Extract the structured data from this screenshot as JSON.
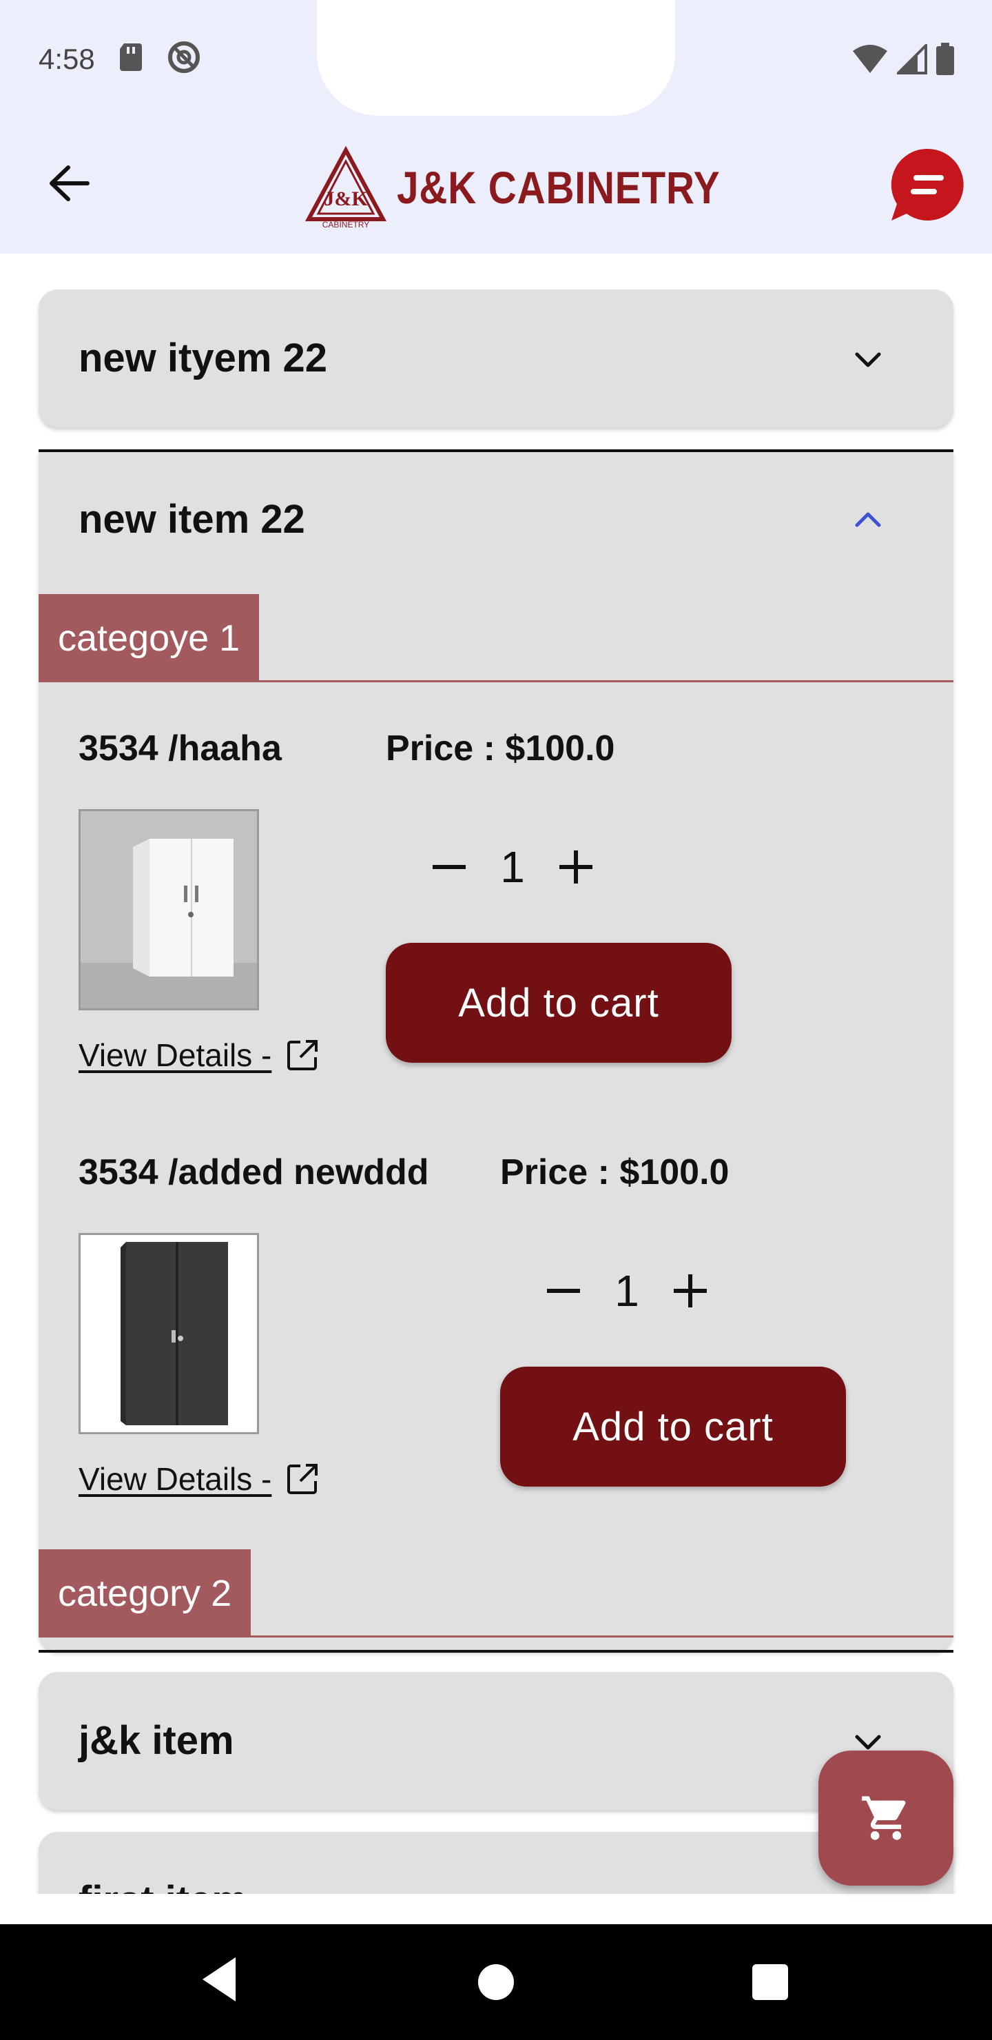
{
  "status_bar": {
    "time": "4:58",
    "icons": [
      "sd-card-icon",
      "do-not-disturb-icon",
      "wifi-icon",
      "signal-icon",
      "battery-icon"
    ]
  },
  "app_bar": {
    "logo_text": "J&K CABINETRY",
    "logo_mark_text": "J&K",
    "logo_mark_sub": "CABINETRY",
    "icons": [
      "back-arrow-icon",
      "chat-bubble-icon"
    ]
  },
  "sections": [
    {
      "title": "new ityem 22",
      "expanded": false
    },
    {
      "title": "new item 22",
      "expanded": true,
      "categories": [
        {
          "name": "categoye 1",
          "products": [
            {
              "name": "3534 /haaha",
              "price": "Price : $100.0",
              "quantity": "1",
              "view_details": "View Details -",
              "add_to_cart": "Add to cart",
              "image": "white-cabinet"
            },
            {
              "name": "3534 /added newddd",
              "price": "Price : $100.0",
              "quantity": "1",
              "view_details": "View Details -",
              "add_to_cart": "Add to cart",
              "image": "black-cabinet"
            }
          ]
        },
        {
          "name": "category 2",
          "products": []
        }
      ]
    },
    {
      "title": "j&k item",
      "expanded": false
    },
    {
      "title": "first item",
      "expanded": false
    }
  ],
  "cart_fab": {
    "icon": "cart-icon"
  },
  "colors": {
    "header_bg": "#eceefb",
    "card_bg": "#e0e0e0",
    "category_tab": "#a25a5e",
    "button_bg": "#731013",
    "fab_bg": "#a0494e",
    "brand": "#8b1a1f",
    "expanded_chevron": "#3f51d4"
  }
}
